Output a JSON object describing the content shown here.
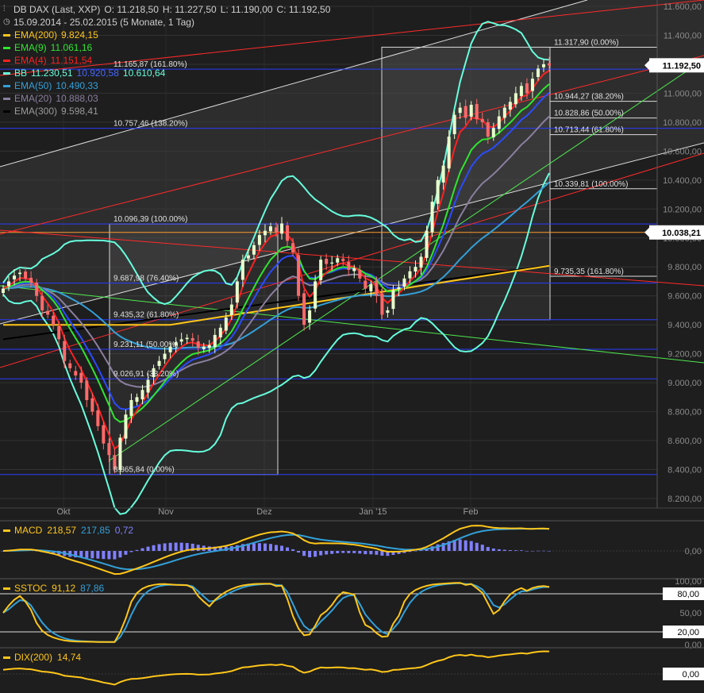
{
  "header": {
    "instrument": "DB DAX (Last, XXP)",
    "ohlc": {
      "o": "O: 11.218,50",
      "h": "H: 11.227,50",
      "l": "L: 11.190,00",
      "c": "C: 11.192,50"
    },
    "range": "15.09.2014 - 25.02.2015 (5 Monate, 1 Tag)"
  },
  "indicators": [
    {
      "id": "ema200",
      "label": "EMA(200)",
      "value": "9.824,15",
      "color": "#ffc61a"
    },
    {
      "id": "ema9",
      "label": "EMA(9)",
      "value": "11.061,16",
      "color": "#2ee62e"
    },
    {
      "id": "ema4",
      "label": "EMA(4)",
      "value": "11.151,54",
      "color": "#ff2020"
    },
    {
      "id": "bb",
      "label": "BB",
      "value": "11.230,51",
      "value2": "10.920,58",
      "value3": "10.610,64",
      "color": "#66ffdd",
      "color2": "#4466ff"
    },
    {
      "id": "ema50",
      "label": "EMA(50)",
      "value": "10.490,33",
      "color": "#33a0d8"
    },
    {
      "id": "ema20",
      "label": "EMA(20)",
      "value": "10.888,03",
      "color": "#8a7f9e"
    },
    {
      "id": "ema300",
      "label": "EMA(300)",
      "value": "9.598,41",
      "color": "#000000"
    }
  ],
  "colors": {
    "background": "#1e1e1e",
    "grid": "#3a3a3a",
    "up": "#e8ffcc",
    "down": "#ff6a6a",
    "fib": "#2a3cff",
    "trend_red": "#ff2a2a",
    "trend_green": "#4ee84e"
  },
  "price_axis": {
    "labels": [
      "11.600,00",
      "11.400,00",
      "11.200,00",
      "11.000,00",
      "10.800,00",
      "10.600,00",
      "10.400,00",
      "10.200,00",
      "10.000,00",
      "9.800,00",
      "9.600,00",
      "9.400,00",
      "9.200,00",
      "9.000,00",
      "8.800,00",
      "8.600,00",
      "8.400,00",
      "8.200,00"
    ],
    "last_price_label": "11.192,50",
    "marker_label": "10.038,21"
  },
  "time_axis": {
    "labels": [
      "Okt",
      "Nov",
      "Dez",
      "Jan '15",
      "Feb"
    ]
  },
  "fib_left": [
    {
      "price": 10096.39,
      "label": "10.096,39 (100.00%)"
    },
    {
      "price": 9687.98,
      "label": "9.687,98 (76.40%)"
    },
    {
      "price": 9435.32,
      "label": "9.435,32 (61.80%)"
    },
    {
      "price": 9231.11,
      "label": "9.231,11 (50.00%)"
    },
    {
      "price": 9026.91,
      "label": "9.026,91 (38.20%)"
    },
    {
      "price": 8365.84,
      "label": "8.365,84 (0.00%)"
    }
  ],
  "fib_top": [
    {
      "price": 11165.87,
      "label": "11.165,87 (161.80%)"
    },
    {
      "price": 10757.46,
      "label": "10.757,46 (138.20%)"
    }
  ],
  "fib_right": [
    {
      "price": 11317.9,
      "label": "11.317,90 (0.00%)"
    },
    {
      "price": 10944.27,
      "label": "10.944,27 (38.20%)"
    },
    {
      "price": 10828.86,
      "label": "10.828,86 (50.00%)"
    },
    {
      "price": 10713.44,
      "label": "10.713,44 (61.80%)"
    },
    {
      "price": 10339.81,
      "label": "10.339,81 (100.00%)"
    },
    {
      "price": 9735.35,
      "label": "9.735,35 (161.80%)"
    }
  ],
  "panels": {
    "macd": {
      "label": "MACD",
      "v1": "218,57",
      "v2": "217,85",
      "v3": "0,72",
      "axis_label": "0,00"
    },
    "sstoc": {
      "label": "SSTOC",
      "v1": "91,12",
      "v2": "87,86",
      "axis_labels": [
        "100,00",
        "80,00",
        "50,00",
        "20,00",
        "0,00"
      ]
    },
    "dix": {
      "label": "DIX(200)",
      "v1": "14,74",
      "axis_label": "0,00"
    }
  },
  "chart_data": {
    "type": "candlestick",
    "ylim": [
      8200,
      11600
    ],
    "series_close": [
      {
        "name": "DAX",
        "values": [
          9650,
          9700,
          9740,
          9760,
          9720,
          9690,
          9600,
          9500,
          9470,
          9400,
          9300,
          9150,
          9100,
          9050,
          9000,
          8880,
          8800,
          8700,
          8580,
          8500,
          8400,
          8620,
          8780,
          8880,
          8900,
          8950,
          9020,
          9100,
          9150,
          9200,
          9250,
          9280,
          9300,
          9310,
          9290,
          9240,
          9250,
          9260,
          9330,
          9380,
          9450,
          9540,
          9700,
          9850,
          9880,
          9950,
          10020,
          10050,
          10080,
          10040,
          10100,
          9980,
          9900,
          9600,
          9400,
          9500,
          9700,
          9850,
          9820,
          9830,
          9860,
          9840,
          9780,
          9790,
          9720,
          9650,
          9680,
          9600,
          9470,
          9500,
          9640,
          9660,
          9720,
          9770,
          9800,
          9870,
          10050,
          10250,
          10400,
          10500,
          10700,
          10850,
          10900,
          10830,
          10920,
          10820,
          10800,
          10700,
          10760,
          10840,
          10900,
          10940,
          11000,
          11050,
          11000,
          11100,
          11170,
          11200,
          11192
        ]
      }
    ]
  }
}
